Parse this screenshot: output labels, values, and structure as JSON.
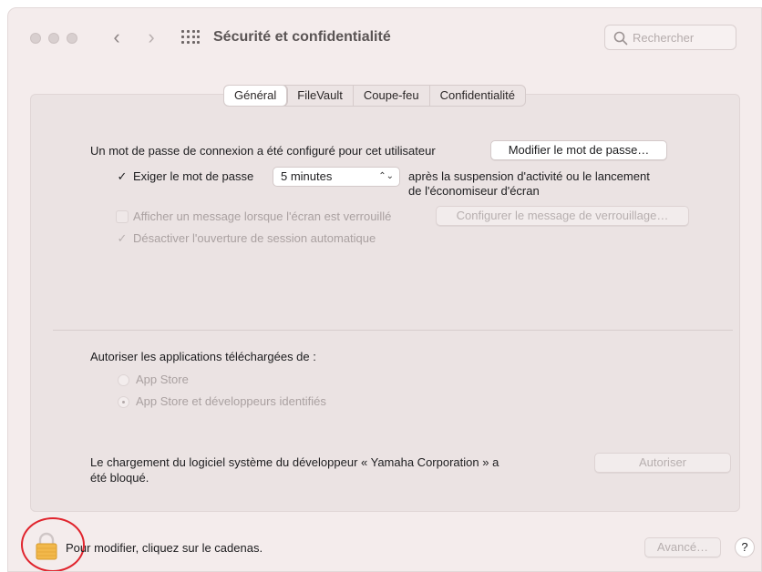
{
  "window": {
    "title": "Sécurité et confidentialité",
    "search_placeholder": "Rechercher"
  },
  "tabs": [
    {
      "label": "Général",
      "active": true
    },
    {
      "label": "FileVault",
      "active": false
    },
    {
      "label": "Coupe-feu",
      "active": false
    },
    {
      "label": "Confidentialité",
      "active": false
    }
  ],
  "general": {
    "password_set_text": "Un mot de passe de connexion a été configuré pour cet utilisateur",
    "change_password_button": "Modifier le mot de passe…",
    "require_password_label": "Exiger le mot de passe",
    "require_password_checked": true,
    "require_password_delay": "5 minutes",
    "after_text_line1": "après la suspension d'activité ou le lancement",
    "after_text_line2": "de l'économiseur d'écran",
    "show_message_label": "Afficher un message lorsque l'écran est verrouillé",
    "show_message_checked": false,
    "configure_message_button": "Configurer le message de verrouillage…",
    "disable_autologin_label": "Désactiver l'ouverture de session automatique",
    "disable_autologin_checked": true
  },
  "apps": {
    "heading": "Autoriser les applications téléchargées de :",
    "options": [
      {
        "label": "App Store",
        "selected": false
      },
      {
        "label": "App Store et développeurs identifiés",
        "selected": true
      }
    ]
  },
  "blocked": {
    "text_line1": "Le chargement du logiciel système du développeur « Yamaha Corporation » a",
    "text_line2": "été bloqué.",
    "allow_button": "Autoriser"
  },
  "footer": {
    "lock_text": "Pour modifier, cliquez sur le cadenas.",
    "advanced_button": "Avancé…",
    "help_button": "?"
  },
  "icons": {
    "search": "search-icon",
    "lock": "lock-icon",
    "grid": "grid-icon",
    "back": "chevron-left-icon",
    "forward": "chevron-right-icon"
  },
  "colors": {
    "window_bg": "#f4ecec",
    "lock_body": "#f2b84b",
    "annotation_ring": "#e0242d"
  }
}
